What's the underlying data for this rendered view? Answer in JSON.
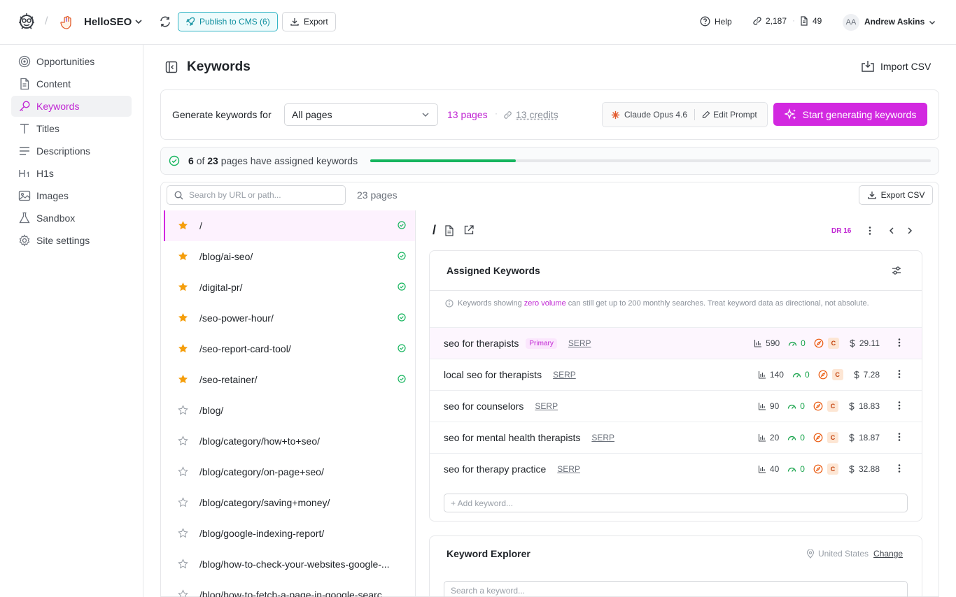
{
  "header": {
    "project_name": "HelloSEO",
    "publish_label": "Publish to CMS (6)",
    "export_label": "Export",
    "help_label": "Help",
    "links_count": "2,187",
    "pages_count": "49",
    "user_initials": "AA",
    "user_name": "Andrew Askins"
  },
  "sidebar": {
    "items": [
      {
        "label": "Opportunities",
        "icon": "target-icon"
      },
      {
        "label": "Content",
        "icon": "document-icon"
      },
      {
        "label": "Keywords",
        "icon": "key-icon",
        "active": true
      },
      {
        "label": "Titles",
        "icon": "text-t-icon"
      },
      {
        "label": "Descriptions",
        "icon": "lines-icon"
      },
      {
        "label": "H1s",
        "icon": "h1-icon"
      },
      {
        "label": "Images",
        "icon": "image-icon"
      },
      {
        "label": "Sandbox",
        "icon": "flask-icon"
      },
      {
        "label": "Site settings",
        "icon": "gear-icon"
      }
    ]
  },
  "main": {
    "title": "Keywords",
    "import_label": "Import CSV"
  },
  "generate": {
    "label": "Generate keywords for",
    "select_value": "All pages",
    "pages": "13 pages",
    "credits": "13 credits",
    "model": "Claude Opus 4.6",
    "edit_prompt": "Edit Prompt",
    "start_label": "Start generating keywords"
  },
  "progress": {
    "done": "6",
    "of": "of",
    "total": "23",
    "suffix": "pages have assigned keywords",
    "fraction": 0.26
  },
  "list": {
    "search_placeholder": "Search by URL or path...",
    "count": "23 pages",
    "export_label": "Export CSV",
    "rows": [
      {
        "url": "/",
        "starred": true,
        "done": true
      },
      {
        "url": "/blog/ai-seo/",
        "starred": true,
        "done": true
      },
      {
        "url": "/digital-pr/",
        "starred": true,
        "done": true
      },
      {
        "url": "/seo-power-hour/",
        "starred": true,
        "done": true
      },
      {
        "url": "/seo-report-card-tool/",
        "starred": true,
        "done": true
      },
      {
        "url": "/seo-retainer/",
        "starred": true,
        "done": true
      },
      {
        "url": "/blog/",
        "starred": false,
        "done": false
      },
      {
        "url": "/blog/category/how+to+seo/",
        "starred": false,
        "done": false
      },
      {
        "url": "/blog/category/on-page+seo/",
        "starred": false,
        "done": false
      },
      {
        "url": "/blog/category/saving+money/",
        "starred": false,
        "done": false
      },
      {
        "url": "/blog/google-indexing-report/",
        "starred": false,
        "done": false
      },
      {
        "url": "/blog/how-to-check-your-websites-google-...",
        "starred": false,
        "done": false
      },
      {
        "url": "/blog/how-to-fetch-a-page-in-google-searc...",
        "starred": false,
        "done": false
      }
    ]
  },
  "detail": {
    "path": "/",
    "dr": "DR 16",
    "assigned_title": "Assigned Keywords",
    "info_pre": "Keywords showing",
    "info_highlight": "zero volume",
    "info_post": "can still get up to 200 monthly searches. Treat keyword data as directional, not absolute.",
    "serp_label": "SERP",
    "primary_label": "Primary",
    "keywords": [
      {
        "keyword": "seo for therapists",
        "primary": true,
        "volume": "590",
        "kd": "0",
        "comp": "C",
        "cpc": "29.11"
      },
      {
        "keyword": "local seo for therapists",
        "primary": false,
        "volume": "140",
        "kd": "0",
        "comp": "C",
        "cpc": "7.28"
      },
      {
        "keyword": "seo for counselors",
        "primary": false,
        "volume": "90",
        "kd": "0",
        "comp": "C",
        "cpc": "18.83"
      },
      {
        "keyword": "seo for mental health therapists",
        "primary": false,
        "volume": "20",
        "kd": "0",
        "comp": "C",
        "cpc": "18.87"
      },
      {
        "keyword": "seo for therapy practice",
        "primary": false,
        "volume": "40",
        "kd": "0",
        "comp": "C",
        "cpc": "32.88"
      }
    ],
    "add_placeholder": "+ Add keyword...",
    "explorer_title": "Keyword Explorer",
    "location": "United States",
    "change_label": "Change",
    "explorer_placeholder": "Search a keyword..."
  },
  "colors": {
    "accent": "#d228e0",
    "success": "#16b55e",
    "teal": "#0f8f9f",
    "star": "#f59e0b"
  }
}
